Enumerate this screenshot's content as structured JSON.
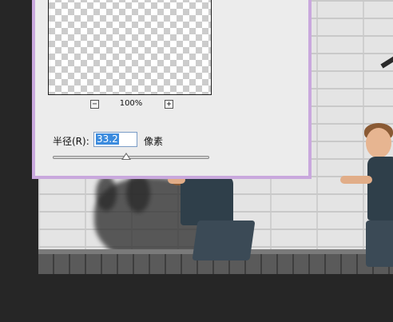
{
  "dialog": {
    "zoom": {
      "level": "100%",
      "zoom_out_icon": "minus-box-icon",
      "zoom_in_icon": "plus-box-icon"
    },
    "radius": {
      "label": "半径(R):",
      "value": "33.2",
      "unit": "像素"
    },
    "slider": {
      "value_fraction": 0.47
    }
  },
  "colors": {
    "dialog_border": "#c9a8dd",
    "dialog_bg": "#ececec",
    "selection": "#3b8bde",
    "app_background": "#262626"
  }
}
